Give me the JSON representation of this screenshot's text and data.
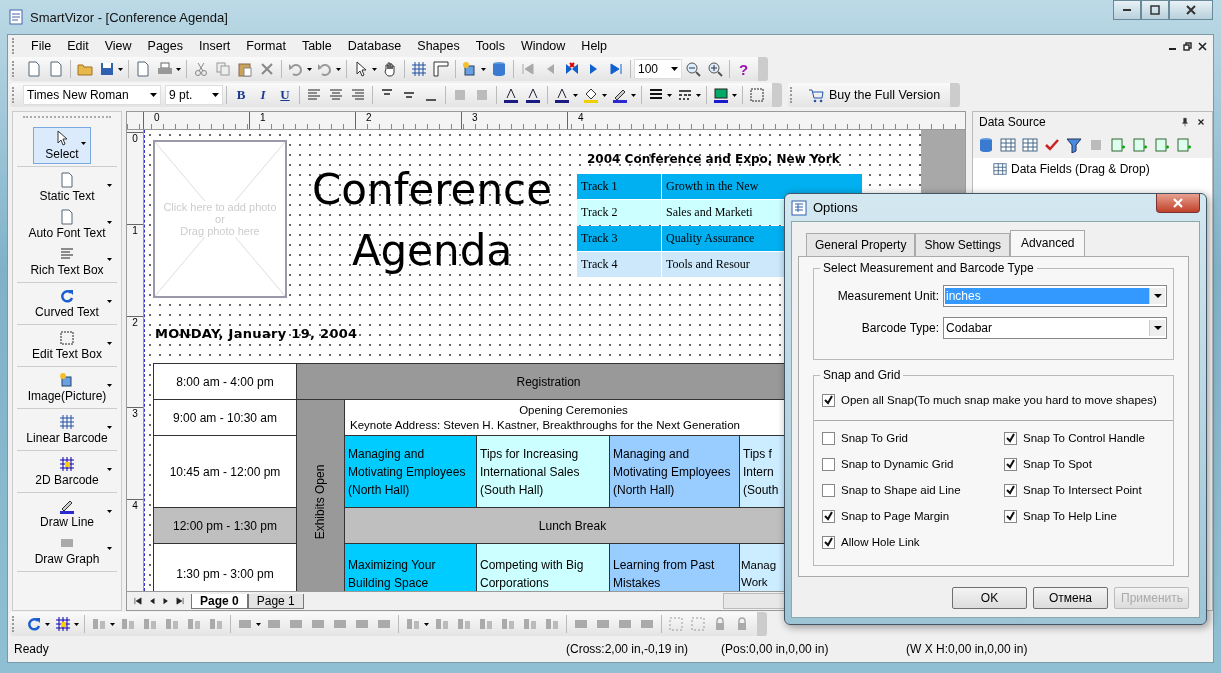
{
  "window": {
    "title": "SmartVizor - [Conference Agenda]"
  },
  "menu": [
    "File",
    "Edit",
    "View",
    "Pages",
    "Insert",
    "Format",
    "Table",
    "Database",
    "Shapes",
    "Tools",
    "Window",
    "Help"
  ],
  "toolbar": {
    "zoom": "100",
    "help_glyph": "?"
  },
  "format_bar": {
    "font": "Times New Roman",
    "size": "9 pt.",
    "style_buttons": [
      "B",
      "I",
      "U"
    ],
    "buy_label": "Buy the Full Version"
  },
  "toolbox": {
    "groups": [
      [
        {
          "label": "Select",
          "selected": true
        }
      ],
      [
        {
          "label": "Static Text",
          "selected": false
        },
        {
          "label": "Auto Font Text",
          "selected": false
        },
        {
          "label": "Rich Text Box",
          "selected": false
        }
      ],
      [
        {
          "label": "Curved Text",
          "selected": false
        }
      ],
      [
        {
          "label": "Edit Text Box",
          "selected": false
        }
      ],
      [
        {
          "label": "Image(Picture)",
          "selected": false
        }
      ],
      [
        {
          "label": "Linear Barcode",
          "selected": false
        }
      ],
      [
        {
          "label": "2D Barcode",
          "selected": false
        }
      ],
      [
        {
          "label": "Draw Line",
          "selected": false
        },
        {
          "label": "Draw Graph",
          "selected": false
        }
      ]
    ]
  },
  "rulers": {
    "horizontal": [
      "0",
      "1",
      "2",
      "3",
      "4"
    ],
    "vertical": [
      "0",
      "1",
      "2",
      "3",
      "4"
    ]
  },
  "page": {
    "photo_hint": "Click here to add photo\nor\nDrag photo here",
    "title": "Conference\nAgenda",
    "subtitle": "2004 Conference and Expo, New York",
    "tracks": [
      {
        "track": "Track 1",
        "topic": "Growth in the New",
        "color": "#00b0f0"
      },
      {
        "track": "Track 2",
        "topic": "Sales and Marketi",
        "color": "#ccffff"
      },
      {
        "track": "Track 3",
        "topic": "Quality Assurance",
        "color": "#00b0f0"
      },
      {
        "track": "Track 4",
        "topic": "Tools and Resour",
        "color": "#cce8fa"
      }
    ],
    "date": "MONDAY, January 19, 2004",
    "schedule": {
      "side_label": "Exhibits Open",
      "rows": [
        {
          "time": "8:00 am - 4:00 pm",
          "kind": "banner",
          "text": "Registration"
        },
        {
          "time": "9:00 am - 10:30 am",
          "kind": "opening",
          "lines": [
            "Opening Ceremonies",
            "Keynote Address: Steven H. Kastner, Breakthroughs for the Next Generation"
          ]
        },
        {
          "time": "10:45 am - 12:00 pm",
          "kind": "sessions",
          "sessions": [
            {
              "text": "Managing and Motivating Employees (North Hall)",
              "color": "#00ccff"
            },
            {
              "text": "Tips for Increasing International Sales (South Hall)",
              "color": "#ccffff"
            },
            {
              "text": "Managing and Motivating Employees (North Hall)",
              "color": "#99ccff"
            },
            {
              "text": "Tips f\nIntern\n(South",
              "color": "#ccecff"
            }
          ]
        },
        {
          "time": "12:00 pm - 1:30 pm",
          "kind": "break",
          "text": "Lunch Break"
        },
        {
          "time": "1:30 pm - 3:00 pm",
          "kind": "sessions",
          "sessions": [
            {
              "text": "Maximizing Your Building Space",
              "color": "#00ccff"
            },
            {
              "text": "Competing with Big Corporations",
              "color": "#ccffff"
            },
            {
              "text": "Learning from Past Mistakes",
              "color": "#99ccff"
            },
            {
              "text": "Manag\nWork",
              "color": "#ccecff"
            }
          ]
        }
      ]
    }
  },
  "page_tabs": [
    {
      "label": "Page  0",
      "selected": true
    },
    {
      "label": "Page  1",
      "selected": false
    }
  ],
  "data_source": {
    "title": "Data Source",
    "items": [
      "Data Fields (Drag & Drop)"
    ]
  },
  "status_bar": {
    "state": "Ready",
    "cross": "(Cross:2,00 in,-0,19 in)",
    "pos": "(Pos:0,00 in,0,00 in)",
    "size": "(W X H:0,00 in,0,00 in)"
  },
  "dialog": {
    "title": "Options",
    "tabs": [
      {
        "label": "General Property",
        "selected": false
      },
      {
        "label": "Show Settings",
        "selected": false
      },
      {
        "label": "Advanced",
        "selected": true
      }
    ],
    "measure_group": "Select Measurement and Barcode Type",
    "fields": [
      {
        "label": "Measurement Unit:",
        "value": "inches",
        "selected": true
      },
      {
        "label": "Barcode Type:",
        "value": "Codabar",
        "selected": false
      }
    ],
    "snap_group": "Snap and Grid",
    "master": {
      "label": "Open all Snap(To much snap make you hard to move shapes)",
      "checked": true
    },
    "options": [
      {
        "label": "Snap To Grid",
        "checked": false
      },
      {
        "label": "Snap To Control Handle",
        "checked": true
      },
      {
        "label": "Snap to Dynamic Grid",
        "checked": false
      },
      {
        "label": "Snap To Spot",
        "checked": true
      },
      {
        "label": "Snap to Shape aid Line",
        "checked": false
      },
      {
        "label": "Snap To Intersect Point",
        "checked": true
      },
      {
        "label": "Snap to Page Margin",
        "checked": true
      },
      {
        "label": "Snap To Help Line",
        "checked": true
      },
      {
        "label": "Allow Hole Link",
        "checked": true
      }
    ],
    "buttons": [
      {
        "label": "OK",
        "disabled": false
      },
      {
        "label": "Отмена",
        "disabled": false
      },
      {
        "label": "Применить",
        "disabled": true
      }
    ]
  }
}
